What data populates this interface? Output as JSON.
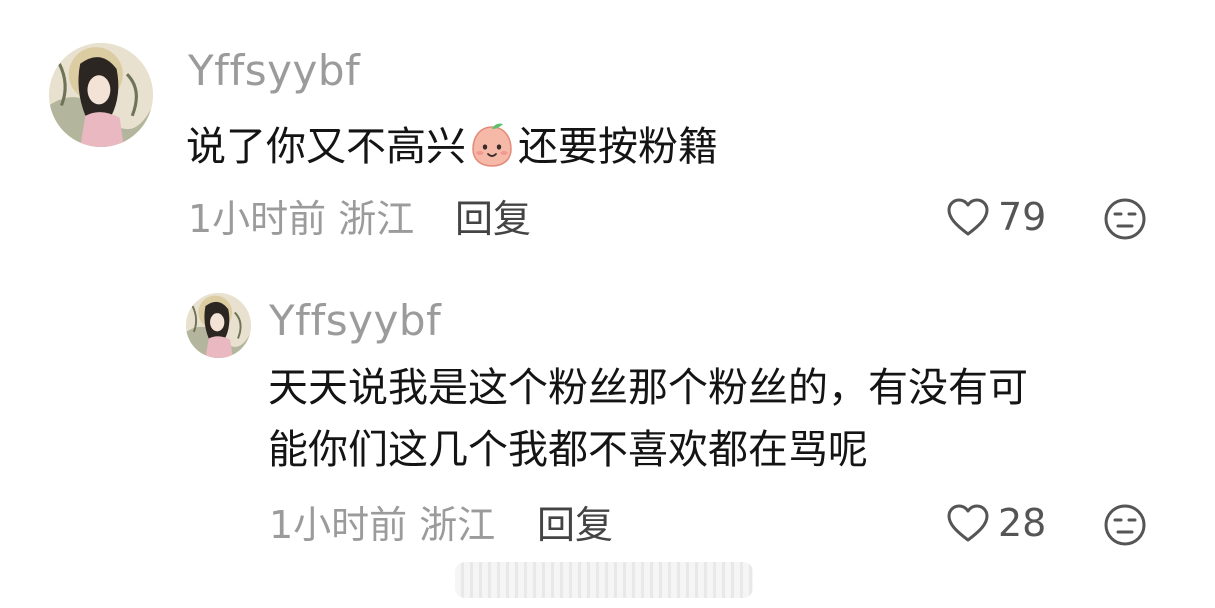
{
  "comments": [
    {
      "username": "Yffsyybf",
      "text_part1": "说了你又不高兴",
      "emoji": "peach-face-emoji",
      "text_part2": "还要按粉籍",
      "time": "1小时前",
      "location": "浙江",
      "reply_label": "回复",
      "likes": "79"
    }
  ],
  "replies": [
    {
      "username": "Yffsyybf",
      "text_line1": "天天说我是这个粉丝那个粉丝的，有没有可",
      "text_line2": "能你们这几个我都不喜欢都在骂呢",
      "time": "1小时前",
      "location": "浙江",
      "reply_label": "回复",
      "likes": "28"
    }
  ],
  "icons": {
    "like": "heart-outline-icon",
    "dislike": "meh-face-icon"
  },
  "colors": {
    "username": "#9b9b9b",
    "text": "#141414",
    "meta": "#9b9b9b"
  }
}
